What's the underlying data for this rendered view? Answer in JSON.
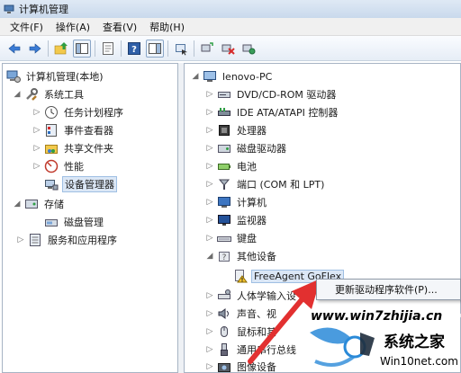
{
  "window": {
    "title": "计算机管理"
  },
  "menu": [
    "文件(F)",
    "操作(A)",
    "查看(V)",
    "帮助(H)"
  ],
  "toolbar_icons": [
    "back-arrow-icon",
    "forward-arrow-icon",
    "up-folder-icon",
    "show-hide-tree-icon",
    "properties-icon",
    "help-icon",
    "show-hide-action-icon",
    "action-icon",
    "scan-hardware-icon",
    "uninstall-icon",
    "update-driver-icon"
  ],
  "left_tree": [
    {
      "label": "计算机管理(本地)",
      "level": 0,
      "icon": "computer-management-icon",
      "expander": "none"
    },
    {
      "label": "系统工具",
      "level": 1,
      "icon": "system-tools-icon",
      "expander": "expanded"
    },
    {
      "label": "任务计划程序",
      "level": 2,
      "icon": "task-scheduler-icon",
      "expander": "collapsed"
    },
    {
      "label": "事件查看器",
      "level": 2,
      "icon": "event-viewer-icon",
      "expander": "collapsed"
    },
    {
      "label": "共享文件夹",
      "level": 2,
      "icon": "shared-folders-icon",
      "expander": "collapsed"
    },
    {
      "label": "性能",
      "level": 2,
      "icon": "performance-icon",
      "expander": "collapsed"
    },
    {
      "label": "设备管理器",
      "level": 2,
      "icon": "device-manager-icon",
      "expander": "none",
      "selected": true
    },
    {
      "label": "存储",
      "level": 1,
      "icon": "storage-icon",
      "expander": "expanded"
    },
    {
      "label": "磁盘管理",
      "level": 2,
      "icon": "disk-management-icon",
      "expander": "none"
    },
    {
      "label": "服务和应用程序",
      "level": 1,
      "icon": "services-apps-icon",
      "expander": "collapsed"
    }
  ],
  "right_tree": [
    {
      "label": "lenovo-PC",
      "level": 0,
      "icon": "computer-icon",
      "expander": "expanded"
    },
    {
      "label": "DVD/CD-ROM 驱动器",
      "level": 1,
      "icon": "dvd-drive-icon",
      "expander": "collapsed"
    },
    {
      "label": "IDE ATA/ATAPI 控制器",
      "level": 1,
      "icon": "ide-controller-icon",
      "expander": "collapsed"
    },
    {
      "label": "处理器",
      "level": 1,
      "icon": "processor-icon",
      "expander": "collapsed"
    },
    {
      "label": "磁盘驱动器",
      "level": 1,
      "icon": "disk-drive-icon",
      "expander": "collapsed"
    },
    {
      "label": "电池",
      "level": 1,
      "icon": "battery-icon",
      "expander": "collapsed"
    },
    {
      "label": "端口 (COM 和 LPT)",
      "level": 1,
      "icon": "port-icon",
      "expander": "collapsed"
    },
    {
      "label": "计算机",
      "level": 1,
      "icon": "computer-icon",
      "expander": "collapsed"
    },
    {
      "label": "监视器",
      "level": 1,
      "icon": "monitor-icon",
      "expander": "collapsed"
    },
    {
      "label": "键盘",
      "level": 1,
      "icon": "keyboard-icon",
      "expander": "collapsed"
    },
    {
      "label": "其他设备",
      "level": 1,
      "icon": "other-devices-icon",
      "expander": "expanded"
    },
    {
      "label": "FreeAgent GoFlex",
      "level": 2,
      "icon": "warning-device-icon",
      "expander": "none",
      "selected": true
    },
    {
      "label": "人体学输入设",
      "level": 1,
      "icon": "hid-icon",
      "expander": "collapsed"
    },
    {
      "label": "声音、视",
      "level": 1,
      "icon": "sound-icon",
      "expander": "collapsed"
    },
    {
      "label": "鼠标和其",
      "level": 1,
      "icon": "mouse-icon",
      "expander": "collapsed"
    },
    {
      "label": "通用串行总线",
      "level": 1,
      "icon": "usb-icon",
      "expander": "collapsed"
    },
    {
      "label": "图像设备",
      "level": 1,
      "icon": "imaging-icon",
      "expander": "collapsed"
    }
  ],
  "context_menu": {
    "items": [
      "更新驱动程序软件(P)..."
    ]
  },
  "watermark": {
    "site": "www.win7zhijia.cn",
    "brand_cn": "系统之家",
    "brand_en": "Win10net.com"
  }
}
